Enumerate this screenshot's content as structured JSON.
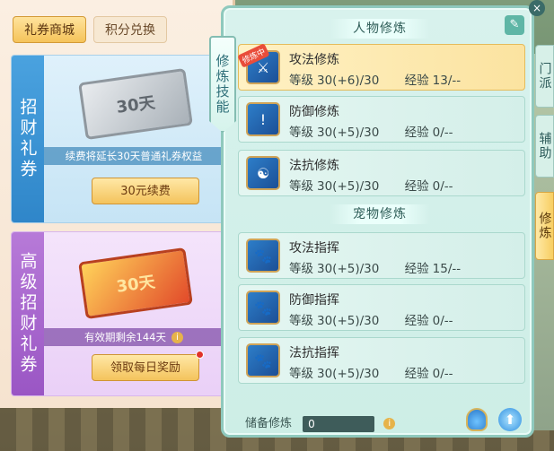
{
  "shop": {
    "tabs": [
      {
        "label": "礼券商城",
        "active": true
      },
      {
        "label": "积分兑换",
        "active": false
      }
    ],
    "card1": {
      "side_title": "招财礼券",
      "ticket_text": "30天",
      "note": "续费将延长30天普通礼券权益",
      "button": "30元续费"
    },
    "card2": {
      "side_title": "高级招财礼券",
      "ticket_text": "30天",
      "note": "有效期剩余144天",
      "button": "领取每日奖励"
    }
  },
  "panel": {
    "side_label": "修炼技能",
    "section_character": "人物修炼",
    "section_pet": "宠物修炼",
    "tag_training": "修炼中",
    "level_label": "等级",
    "exp_label": "经验",
    "character_skills": [
      {
        "name": "攻法修炼",
        "level": "30(+6)/30",
        "exp": "13/--",
        "selected": true
      },
      {
        "name": "防御修炼",
        "level": "30(+5)/30",
        "exp": "0/--",
        "selected": false
      },
      {
        "name": "法抗修炼",
        "level": "30(+5)/30",
        "exp": "0/--",
        "selected": false
      }
    ],
    "pet_skills": [
      {
        "name": "攻法指挥",
        "level": "30(+5)/30",
        "exp": "15/--"
      },
      {
        "name": "防御指挥",
        "level": "30(+5)/30",
        "exp": "0/--"
      },
      {
        "name": "法抗指挥",
        "level": "30(+5)/30",
        "exp": "0/--"
      }
    ],
    "reserve_label": "储备修炼",
    "reserve_value": "0"
  },
  "vtabs": [
    "门派",
    "辅助",
    "修炼"
  ],
  "colors": {
    "accent": "#f5c35a",
    "panel": "#d8f2ed"
  }
}
